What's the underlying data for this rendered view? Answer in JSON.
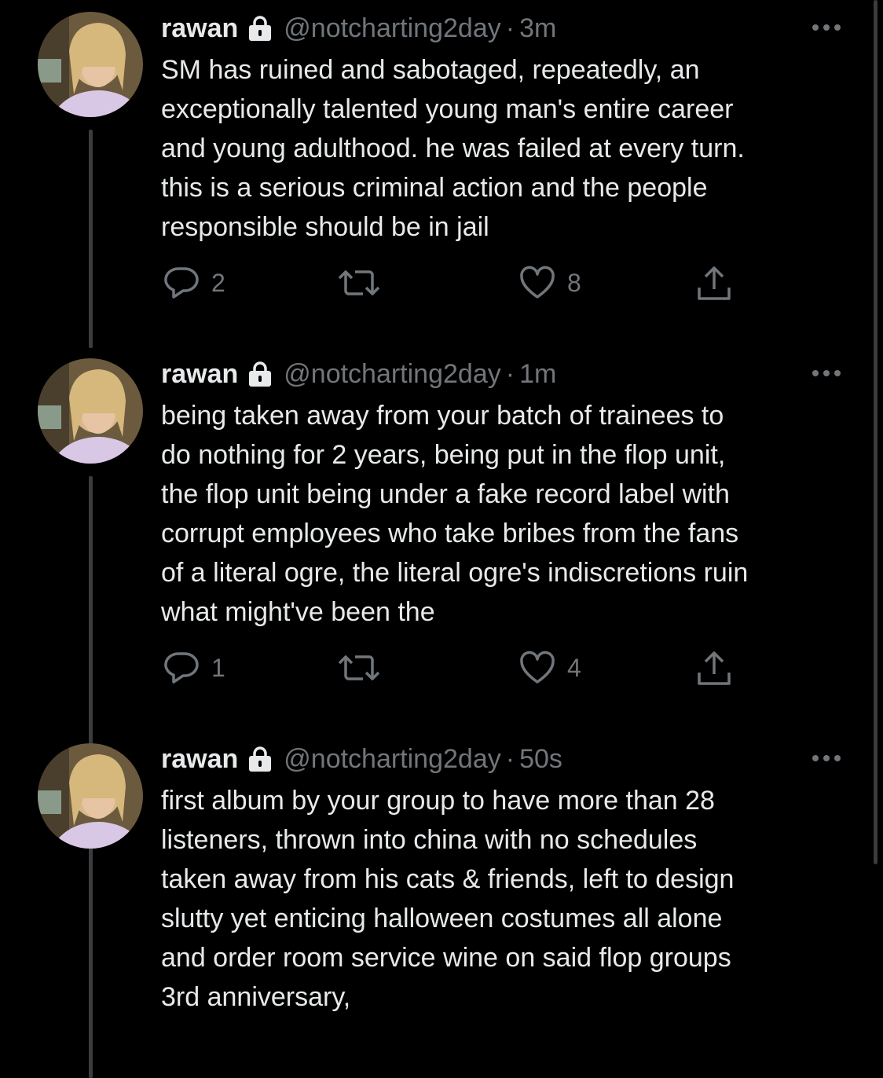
{
  "tweets": [
    {
      "name": "rawan",
      "handle": "@notcharting2day",
      "separator": "·",
      "time": "3m",
      "text": "SM has ruined and sabotaged, repeatedly, an\nexceptionally talented young man's entire career\nand young adulthood. he was failed at every turn.\nthis is a serious criminal action and the people\nresponsible should be in jail",
      "replies": "2",
      "retweets": "",
      "likes": "8"
    },
    {
      "name": "rawan",
      "handle": "@notcharting2day",
      "separator": "·",
      "time": "1m",
      "text": "being taken away from your batch of trainees to\ndo nothing for 2 years, being put in the flop unit,\nthe flop unit being under a fake record label with\ncorrupt employees who take bribes from the fans\nof a literal ogre, the literal ogre's indiscretions ruin\nwhat might've been the",
      "replies": "1",
      "retweets": "",
      "likes": "4"
    },
    {
      "name": "rawan",
      "handle": "@notcharting2day",
      "separator": "·",
      "time": "50s",
      "text": "first album by your group to have more than 28\nlisteners, thrown into china with no schedules\ntaken away from his cats & friends, left to design\nslutty yet enticing halloween costumes all alone\nand order room service wine on said flop groups\n3rd anniversary,"
    }
  ],
  "icons": {
    "lock": "lock-icon",
    "more": "more-icon",
    "reply": "reply-icon",
    "retweet": "retweet-icon",
    "like": "heart-icon",
    "share": "share-icon"
  },
  "colors": {
    "background": "#000000",
    "text": "#e7e9ea",
    "muted": "#71767b",
    "thread_line": "#3a3c3f"
  }
}
